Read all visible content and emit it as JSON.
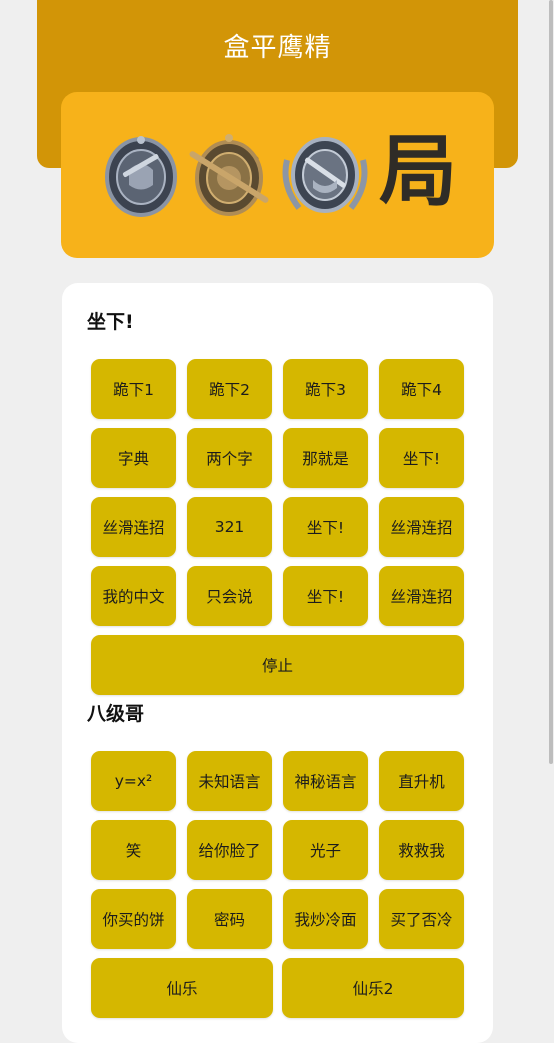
{
  "header": {
    "title": "盒平鹰精"
  },
  "banner": {
    "badges": [
      "silver-rank-badge-icon",
      "bronze-rank-badge-icon",
      "silver-laurel-rank-badge-icon"
    ],
    "text": "局"
  },
  "sections": [
    {
      "title": "坐下!",
      "buttons": [
        "跪下1",
        "跪下2",
        "跪下3",
        "跪下4",
        "字典",
        "两个字",
        "那就是",
        "坐下!",
        "丝滑连招",
        "321",
        "坐下!",
        "丝滑连招",
        "我的中文",
        "只会说",
        "坐下!",
        "丝滑连招"
      ],
      "wide_button": "停止"
    },
    {
      "title": "八级哥",
      "buttons": [
        "y=x²",
        "未知语言",
        "神秘语言",
        "直升机",
        "笑",
        "给你脸了",
        "光子",
        "救救我",
        "你买的饼",
        "密码",
        "我炒冷面",
        "买了否冷"
      ],
      "half_buttons": [
        "仙乐",
        "仙乐2"
      ]
    }
  ],
  "colors": {
    "header_bg": "#d29507",
    "banner_bg": "#f7b21a",
    "button_bg": "#d5b700",
    "page_bg": "#efefef"
  }
}
